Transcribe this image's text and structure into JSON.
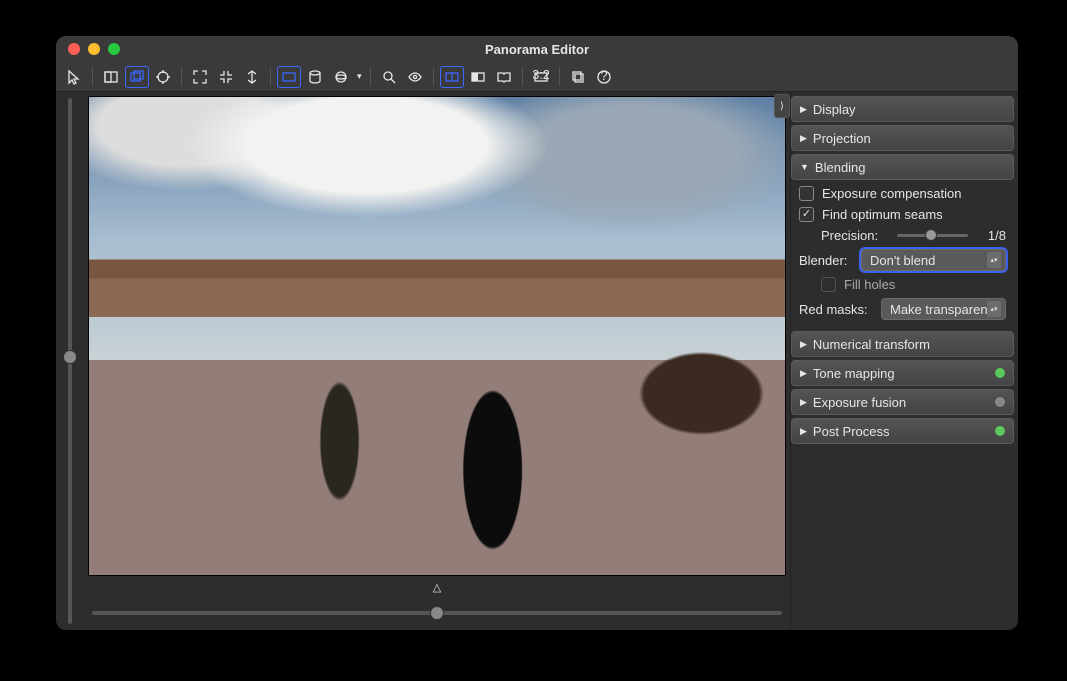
{
  "window": {
    "title": "Panorama Editor"
  },
  "toolbar": {
    "buttons": [
      "pointer",
      "spacer",
      "grid-single",
      "grid-multi",
      "center-point",
      "sep",
      "fit",
      "shrink",
      "fit-vert",
      "sep",
      "proj-rect",
      "proj-cyl",
      "proj-sphere",
      "dropdown",
      "sep",
      "zoom",
      "eye",
      "sep",
      "compare-split",
      "compare-half",
      "compare-book",
      "sep",
      "aspect",
      "sep",
      "export",
      "help"
    ]
  },
  "panels": {
    "display": {
      "label": "Display",
      "expanded": false
    },
    "projection": {
      "label": "Projection",
      "expanded": false
    },
    "blending": {
      "label": "Blending",
      "expanded": true,
      "exposure_comp": {
        "label": "Exposure compensation",
        "checked": false
      },
      "find_seams": {
        "label": "Find optimum seams",
        "checked": true
      },
      "precision": {
        "label": "Precision:",
        "value": "1/8"
      },
      "blender": {
        "label": "Blender:",
        "value": "Don't blend"
      },
      "fill_holes": {
        "label": "Fill holes",
        "checked": false,
        "disabled": true
      },
      "red_masks": {
        "label": "Red masks:",
        "value": "Make transparent"
      }
    },
    "numerical": {
      "label": "Numerical transform",
      "expanded": false
    },
    "tone": {
      "label": "Tone mapping",
      "expanded": false,
      "status": "green"
    },
    "exposure_fusion": {
      "label": "Exposure fusion",
      "expanded": false,
      "status": "grey"
    },
    "post": {
      "label": "Post Process",
      "expanded": false,
      "status": "green"
    }
  }
}
